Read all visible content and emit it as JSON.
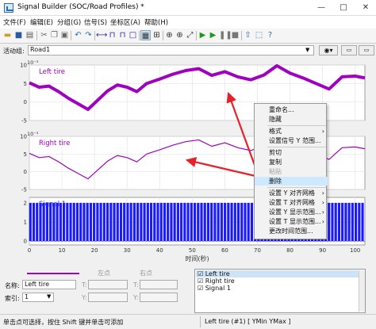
{
  "window": {
    "title": "Signal Builder (SOC/Road Profiles) *",
    "controls": [
      "—",
      "□",
      "✕"
    ]
  },
  "menu": [
    "文件(F)",
    "编辑(E)",
    "分组(G)",
    "信号(S)",
    "坐标区(A)",
    "帮助(H)"
  ],
  "toolbar": {
    "icons": [
      "open-icon",
      "save-icon",
      "print-icon",
      "cut-icon",
      "copy-icon",
      "paste-icon",
      "undo-icon",
      "redo-icon",
      "redo-icon",
      "hline-icon",
      "step-icon",
      "pulse-icon",
      "square-icon",
      "sine-icon",
      "grid-icon",
      "table-icon",
      "zoom-x-icon",
      "zoom-y-icon",
      "zoom-icon",
      "fit-icon",
      "play-icon",
      "play-all-icon",
      "pause-icon",
      "stop-icon",
      "upload-icon",
      "simulink-icon",
      "help-icon"
    ]
  },
  "group": {
    "label": "活动组:",
    "value": "Road1"
  },
  "context_menu": {
    "items": [
      {
        "label": "重命名...",
        "submenu": false,
        "disabled": false,
        "highlight": false,
        "sep_before": false
      },
      {
        "label": "隐藏",
        "submenu": false,
        "disabled": false,
        "highlight": false,
        "sep_before": false
      },
      {
        "label": "格式",
        "submenu": true,
        "disabled": false,
        "highlight": false,
        "sep_before": true
      },
      {
        "label": "设置信号 Y 范围...",
        "submenu": false,
        "disabled": false,
        "highlight": false,
        "sep_before": false
      },
      {
        "label": "剪切",
        "submenu": false,
        "disabled": false,
        "highlight": false,
        "sep_before": true
      },
      {
        "label": "复制",
        "submenu": false,
        "disabled": false,
        "highlight": false,
        "sep_before": false
      },
      {
        "label": "粘贴",
        "submenu": false,
        "disabled": true,
        "highlight": false,
        "sep_before": false
      },
      {
        "label": "删除",
        "submenu": false,
        "disabled": false,
        "highlight": true,
        "sep_before": false
      },
      {
        "label": "设置 Y 对齐网格",
        "submenu": true,
        "disabled": false,
        "highlight": false,
        "sep_before": true
      },
      {
        "label": "设置 T 对齐网格",
        "submenu": true,
        "disabled": false,
        "highlight": false,
        "sep_before": false
      },
      {
        "label": "设置 Y 显示范围...",
        "submenu": true,
        "disabled": false,
        "highlight": false,
        "sep_before": false
      },
      {
        "label": "设置 T 显示范围...",
        "submenu": true,
        "disabled": false,
        "highlight": false,
        "sep_before": false
      },
      {
        "label": "更改时间范围...",
        "submenu": false,
        "disabled": false,
        "highlight": false,
        "sep_before": false
      }
    ]
  },
  "chart_data": [
    {
      "type": "line",
      "title": "Left tire",
      "exponent_label": "10⁻³",
      "x_ticks": [
        0,
        10,
        20,
        30,
        40,
        50,
        60,
        70,
        80,
        90,
        100
      ],
      "ylim": [
        -5,
        10
      ],
      "y_ticks": [
        -5,
        0,
        5,
        10
      ],
      "color": "#a000c0",
      "x": [
        0,
        3,
        6,
        9,
        12,
        15,
        18,
        21,
        24,
        27,
        30,
        33,
        36,
        40,
        44,
        48,
        52,
        56,
        60,
        64,
        68,
        72,
        76,
        80,
        84,
        88,
        92,
        96,
        100,
        103
      ],
      "y": [
        5.2,
        4.0,
        4.3,
        2.8,
        1.0,
        -0.5,
        -2.0,
        0.5,
        3.0,
        4.6,
        4.0,
        2.8,
        5.0,
        6.2,
        7.5,
        8.5,
        9.0,
        7.2,
        8.2,
        6.8,
        6.0,
        7.3,
        9.8,
        7.8,
        6.5,
        5.0,
        3.5,
        6.8,
        7.0,
        6.5
      ]
    },
    {
      "type": "line",
      "title": "Right tire",
      "exponent_label": "10⁻³",
      "x_ticks": [
        0,
        10,
        20,
        30,
        40,
        50,
        60,
        70,
        80,
        90,
        100
      ],
      "ylim": [
        -5,
        10
      ],
      "y_ticks": [
        -5,
        0,
        5,
        10
      ],
      "color": "#a000c0",
      "x": [
        0,
        3,
        6,
        9,
        12,
        15,
        18,
        21,
        24,
        27,
        30,
        33,
        36,
        40,
        44,
        48,
        52,
        56,
        60,
        64,
        68,
        72,
        76,
        80,
        84,
        88,
        92,
        96,
        100,
        103
      ],
      "y": [
        5.2,
        4.0,
        4.3,
        2.8,
        1.0,
        -0.5,
        -2.0,
        0.5,
        3.0,
        4.6,
        4.0,
        2.8,
        5.0,
        6.2,
        7.5,
        8.5,
        9.0,
        7.2,
        8.2,
        6.8,
        6.0,
        7.3,
        9.8,
        7.8,
        6.5,
        5.0,
        3.5,
        6.8,
        7.0,
        6.5
      ]
    },
    {
      "type": "area",
      "title": "Signal 1",
      "x_ticks": [
        0,
        10,
        20,
        30,
        40,
        50,
        60,
        70,
        80,
        90,
        100
      ],
      "y_ticks": [
        0,
        1,
        2
      ],
      "ylim": [
        -0.2,
        2.3
      ],
      "color": "#1a1aff",
      "description_values": {
        "low": 0,
        "high": 2
      },
      "pulse_count": 100
    }
  ],
  "x_axis": {
    "ticks": [
      0,
      10,
      20,
      30,
      40,
      50,
      60,
      70,
      80,
      90,
      100
    ],
    "label": "时间(秒)"
  },
  "bottom": {
    "name_label": "名称:",
    "name_value": "Left tire",
    "index_label": "索引:",
    "index_value": "1",
    "left_point": "左点",
    "right_point": "右点",
    "t_label": "T:",
    "y_label": "Y:"
  },
  "signal_list": [
    {
      "label": "Left tire",
      "checked": true
    },
    {
      "label": "Right tire",
      "checked": true
    },
    {
      "label": "Signal 1",
      "checked": true
    }
  ],
  "status": {
    "left": "单击点可选择，按住 Shift 键并单击可添加",
    "right": "Left tire (#1)  [ YMin YMax ]"
  }
}
